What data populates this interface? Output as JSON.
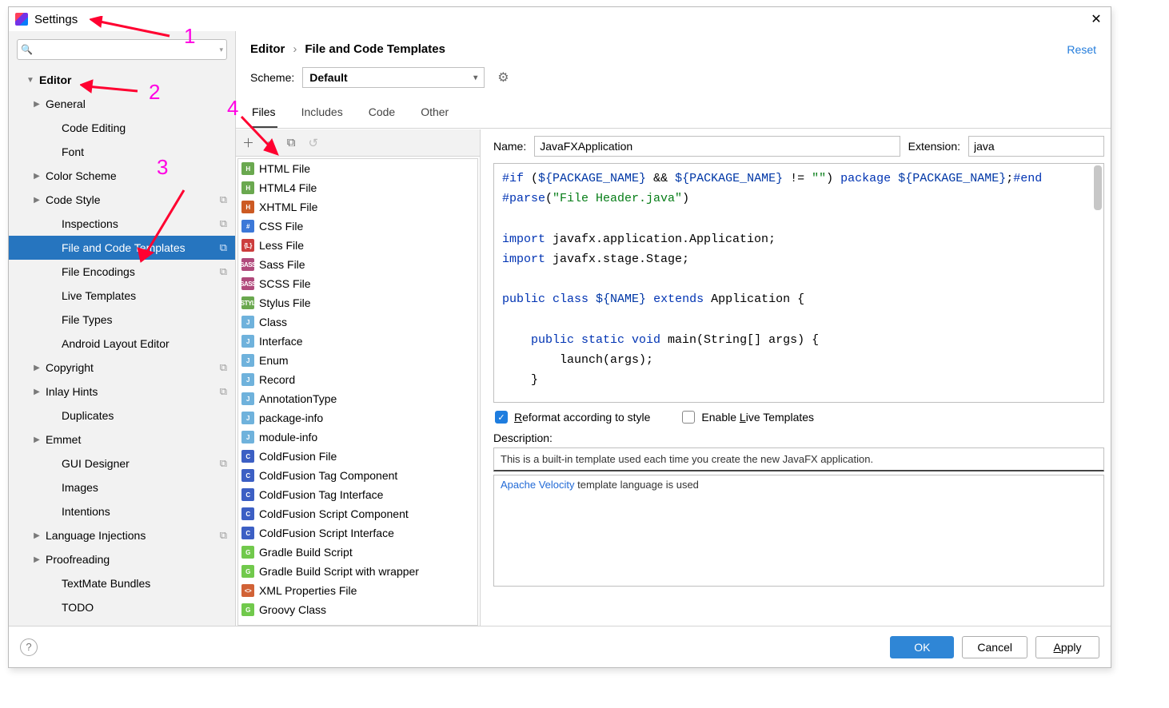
{
  "window": {
    "title": "Settings"
  },
  "search": {
    "placeholder": ""
  },
  "sidebar": {
    "rows": [
      {
        "label": "Editor",
        "bold": true,
        "arrow": "down",
        "lvl": 0
      },
      {
        "label": "General",
        "arrow": "right",
        "lvl": 1
      },
      {
        "label": "Code Editing",
        "lvl": 2
      },
      {
        "label": "Font",
        "lvl": 2
      },
      {
        "label": "Color Scheme",
        "arrow": "right",
        "lvl": 1
      },
      {
        "label": "Code Style",
        "arrow": "right",
        "lvl": 1,
        "badge": "⧉"
      },
      {
        "label": "Inspections",
        "lvl": 2,
        "badge": "⧉"
      },
      {
        "label": "File and Code Templates",
        "lvl": 2,
        "badge": "⧉",
        "selected": true
      },
      {
        "label": "File Encodings",
        "lvl": 2,
        "badge": "⧉"
      },
      {
        "label": "Live Templates",
        "lvl": 2
      },
      {
        "label": "File Types",
        "lvl": 2
      },
      {
        "label": "Android Layout Editor",
        "lvl": 2
      },
      {
        "label": "Copyright",
        "arrow": "right",
        "lvl": 1,
        "badge": "⧉"
      },
      {
        "label": "Inlay Hints",
        "arrow": "right",
        "lvl": 1,
        "badge": "⧉"
      },
      {
        "label": "Duplicates",
        "lvl": 2
      },
      {
        "label": "Emmet",
        "arrow": "right",
        "lvl": 1
      },
      {
        "label": "GUI Designer",
        "lvl": 2,
        "badge": "⧉"
      },
      {
        "label": "Images",
        "lvl": 2
      },
      {
        "label": "Intentions",
        "lvl": 2
      },
      {
        "label": "Language Injections",
        "arrow": "right",
        "lvl": 1,
        "badge": "⧉"
      },
      {
        "label": "Proofreading",
        "arrow": "right",
        "lvl": 1
      },
      {
        "label": "TextMate Bundles",
        "lvl": 2
      },
      {
        "label": "TODO",
        "lvl": 2
      }
    ]
  },
  "breadcrumb": {
    "a": "Editor",
    "b": "File and Code Templates",
    "reset": "Reset"
  },
  "scheme": {
    "label": "Scheme:",
    "value": "Default"
  },
  "tabs": [
    {
      "label": "Files",
      "active": true
    },
    {
      "label": "Includes"
    },
    {
      "label": "Code"
    },
    {
      "label": "Other"
    }
  ],
  "templates": [
    {
      "label": "HTML File",
      "c": "#6aa84f",
      "t": "H"
    },
    {
      "label": "HTML4 File",
      "c": "#6aa84f",
      "t": "H"
    },
    {
      "label": "XHTML File",
      "c": "#cc5a23",
      "t": "H"
    },
    {
      "label": "CSS File",
      "c": "#3c78d8",
      "t": "#"
    },
    {
      "label": "Less File",
      "c": "#cc3d3d",
      "t": "{L}"
    },
    {
      "label": "Sass File",
      "c": "#b0497b",
      "t": "SASS"
    },
    {
      "label": "SCSS File",
      "c": "#b0497b",
      "t": "SASS"
    },
    {
      "label": "Stylus File",
      "c": "#6aa84f",
      "t": "STYL"
    },
    {
      "label": "Class",
      "c": "#6fb2dc",
      "t": "J"
    },
    {
      "label": "Interface",
      "c": "#6fb2dc",
      "t": "J"
    },
    {
      "label": "Enum",
      "c": "#6fb2dc",
      "t": "J"
    },
    {
      "label": "Record",
      "c": "#6fb2dc",
      "t": "J"
    },
    {
      "label": "AnnotationType",
      "c": "#6fb2dc",
      "t": "J"
    },
    {
      "label": "package-info",
      "c": "#6fb2dc",
      "t": "J"
    },
    {
      "label": "module-info",
      "c": "#6fb2dc",
      "t": "J"
    },
    {
      "label": "ColdFusion File",
      "c": "#3c5fc4",
      "t": "C"
    },
    {
      "label": "ColdFusion Tag Component",
      "c": "#3c5fc4",
      "t": "C"
    },
    {
      "label": "ColdFusion Tag Interface",
      "c": "#3c5fc4",
      "t": "C"
    },
    {
      "label": "ColdFusion Script Component",
      "c": "#3c5fc4",
      "t": "C"
    },
    {
      "label": "ColdFusion Script Interface",
      "c": "#3c5fc4",
      "t": "C"
    },
    {
      "label": "Gradle Build Script",
      "c": "#71c94c",
      "t": "G"
    },
    {
      "label": "Gradle Build Script with wrapper",
      "c": "#71c94c",
      "t": "G"
    },
    {
      "label": "XML Properties File",
      "c": "#d16236",
      "t": "<>"
    },
    {
      "label": "Groovy Class",
      "c": "#71c94c",
      "t": "G"
    }
  ],
  "form": {
    "name_label": "Name:",
    "name_value": "JavaFXApplication",
    "ext_label": "Extension:",
    "ext_value": "java"
  },
  "checks": {
    "reformat": "Reformat according to style",
    "livetpl": "Enable Live Templates"
  },
  "description": {
    "label": "Description:",
    "text": "This is a built-in template used each time you create the new JavaFX application.",
    "note_pre": "Apache Velocity",
    "note_post": " template language is used"
  },
  "buttons": {
    "ok": "OK",
    "cancel": "Cancel",
    "apply": "Apply"
  },
  "annotations": {
    "n1": "1",
    "n2": "2",
    "n3": "3",
    "n4": "4"
  }
}
